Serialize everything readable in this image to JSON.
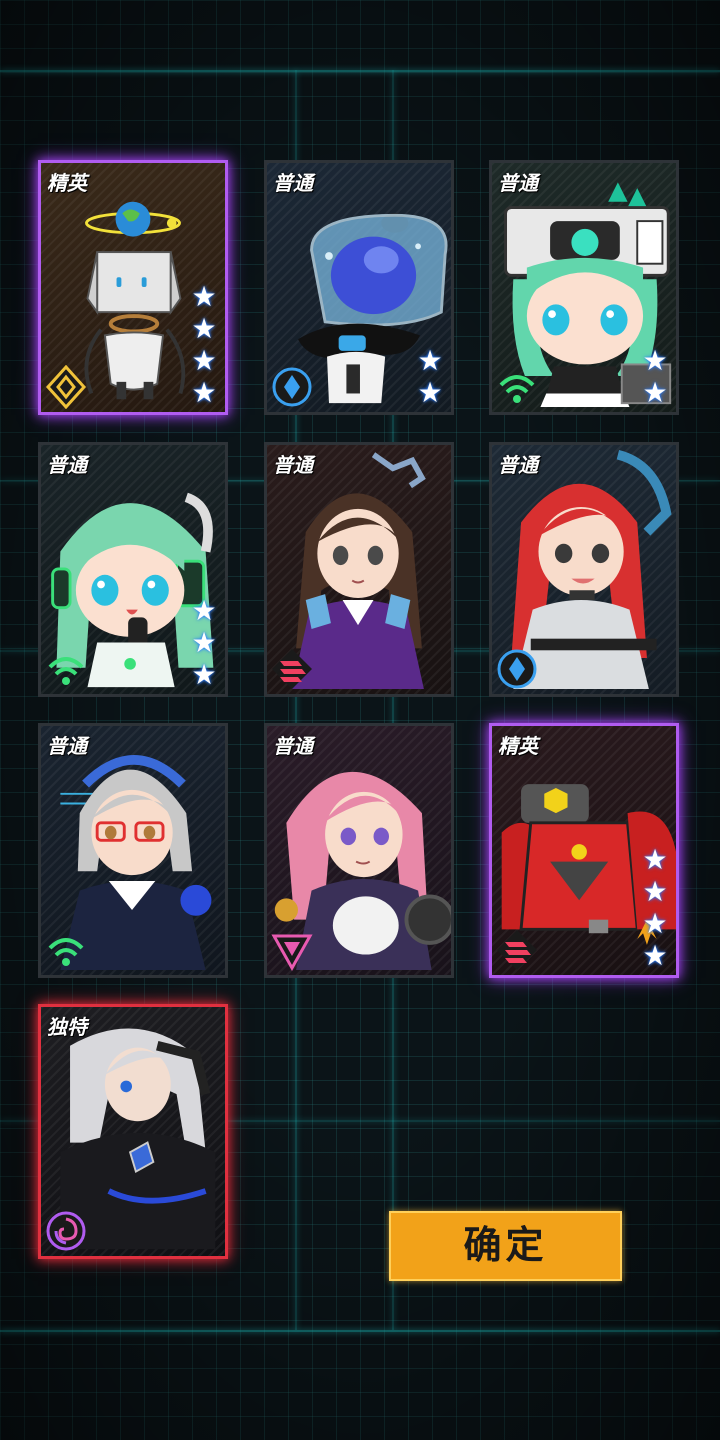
{
  "cards": [
    {
      "rank": "精英",
      "tier": "elite",
      "stars": 4,
      "class_icon": "diamond-class-icon",
      "character": "robot-box-head"
    },
    {
      "rank": "普通",
      "tier": "normal",
      "stars": 2,
      "class_icon": "circle-class-icon",
      "character": "blue-slime-jar"
    },
    {
      "rank": "普通",
      "tier": "normal",
      "stars": 2,
      "class_icon": "wifi-class-icon",
      "character": "green-hair-mech-girl"
    },
    {
      "rank": "普通",
      "tier": "normal",
      "stars": 3,
      "class_icon": "wifi-class-icon",
      "character": "green-hair-headphone-girl"
    },
    {
      "rank": "普通",
      "tier": "normal",
      "stars": 0,
      "class_icon": "bars-class-icon",
      "character": "brown-hair-girl"
    },
    {
      "rank": "普通",
      "tier": "normal",
      "stars": 0,
      "class_icon": "circle-class-icon",
      "character": "red-twintail-girl"
    },
    {
      "rank": "普通",
      "tier": "normal",
      "stars": 0,
      "class_icon": "wifi-class-icon",
      "character": "silver-hair-glasses-girl"
    },
    {
      "rank": "普通",
      "tier": "normal",
      "stars": 0,
      "class_icon": "triangle-class-icon",
      "character": "pink-hair-girl"
    },
    {
      "rank": "精英",
      "tier": "elite",
      "stars": 4,
      "class_icon": "bars-class-icon",
      "character": "red-mech"
    },
    {
      "rank": "独特",
      "tier": "unique",
      "stars": 0,
      "class_icon": "swirl-class-icon",
      "character": "white-hair-woman"
    }
  ],
  "confirm_label": "确定",
  "colors": {
    "elite_border": "#b05cf0",
    "unique_border": "#e0303f",
    "confirm_bg": "#f2a219",
    "star_glow": "#2a7cff"
  }
}
